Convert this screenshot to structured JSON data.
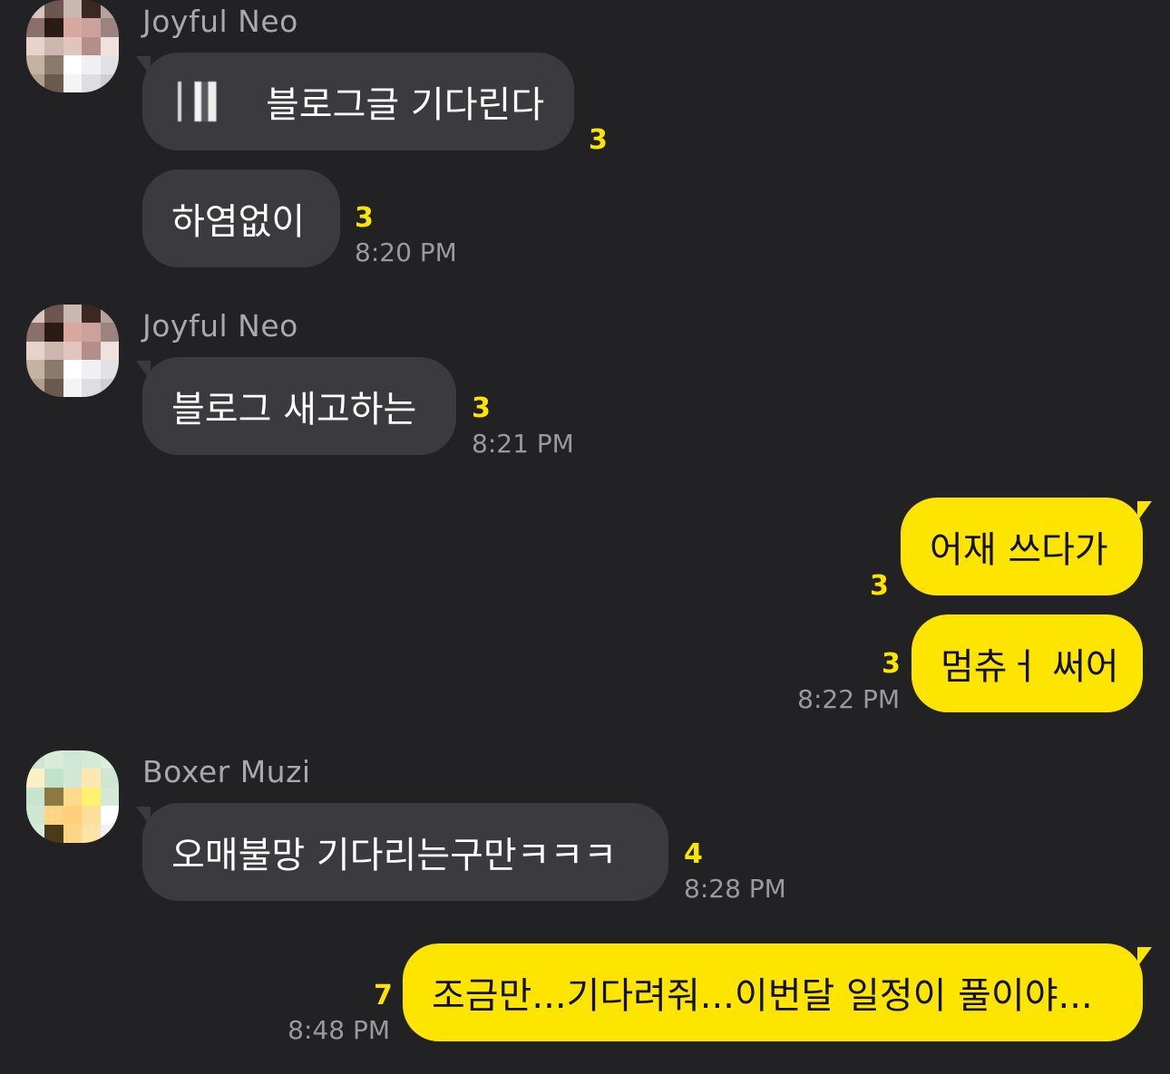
{
  "messages": [
    {
      "sender": "Joyful Neo",
      "texts": [
        "블로그글 기다린다",
        "하염없이"
      ],
      "counts": [
        "3",
        "3"
      ],
      "time": "8:20 PM"
    },
    {
      "sender": "Joyful Neo",
      "texts": [
        "블로그 새고하는"
      ],
      "counts": [
        "3"
      ],
      "time": "8:21 PM"
    },
    {
      "sender": "me",
      "texts": [
        "어재 쓰다가",
        "멈츄ㅓ 써어"
      ],
      "counts": [
        "3",
        "3"
      ],
      "time": "8:22 PM"
    },
    {
      "sender": "Boxer Muzi",
      "texts": [
        "오매불망 기다리는구만ㅋㅋㅋ"
      ],
      "counts": [
        "4"
      ],
      "time": "8:28 PM"
    },
    {
      "sender": "me",
      "texts": [
        "조금만...기다려줘...이번달 일정이 풀이야..."
      ],
      "counts": [
        "7"
      ],
      "time": "8:48 PM"
    }
  ],
  "colors": {
    "background": "#222224",
    "incoming_bubble": "#3b3b3f",
    "outgoing_bubble": "#fee500",
    "unread_count": "#fee500",
    "sender_name": "#a9a9ad",
    "timestamp": "#9a9a9e"
  }
}
